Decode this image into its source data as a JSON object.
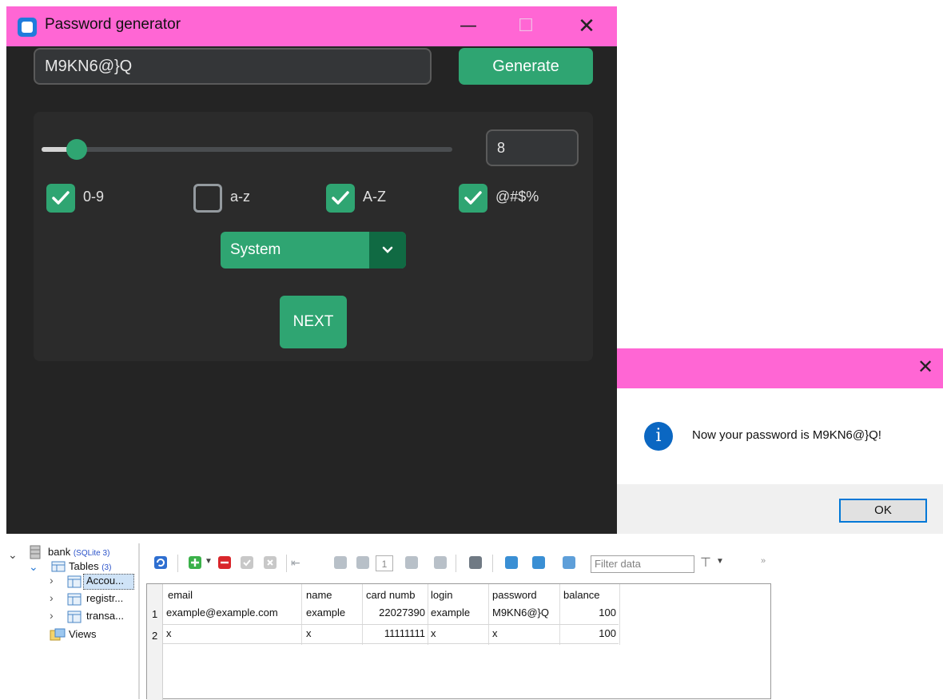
{
  "generator": {
    "title": "Password generator",
    "window_controls": {
      "minimize": "—",
      "maximize": "☐",
      "close": "✕"
    },
    "password": "M9KN6@}Q",
    "generate_label": "Generate",
    "length_fraction": 0.085,
    "length_value": "8",
    "options": [
      {
        "label": "0-9",
        "checked": true
      },
      {
        "label": "a-z",
        "checked": false
      },
      {
        "label": "A-Z",
        "checked": true
      },
      {
        "label": "@#$%",
        "checked": true
      }
    ],
    "mode": "System",
    "next_label": "NEXT",
    "accent": "#2fa572",
    "titlebar_color": "#ff66d4"
  },
  "message_box": {
    "close": "✕",
    "icon": "info-icon",
    "icon_glyph": "i",
    "text": "Now your password is M9KN6@}Q!",
    "ok_label": "OK"
  },
  "db": {
    "tree": {
      "db_name": "bank",
      "db_type": "(SQLite 3)",
      "tables_label": "Tables",
      "tables_count": "(3)",
      "tables": [
        "Accou...",
        "registr...",
        "transa..."
      ],
      "views_label": "Views"
    },
    "filter_placeholder": "Filter data",
    "page_number": "1",
    "columns": [
      "email",
      "name",
      "card numb",
      "login",
      "password",
      "balance"
    ],
    "rows": [
      {
        "num": "1",
        "cells": [
          "example@example.com",
          "example",
          "22027390",
          "example",
          "M9KN6@}Q",
          "100"
        ]
      },
      {
        "num": "2",
        "cells": [
          "x",
          "x",
          "11111111",
          "x",
          "x",
          "100"
        ]
      }
    ]
  }
}
